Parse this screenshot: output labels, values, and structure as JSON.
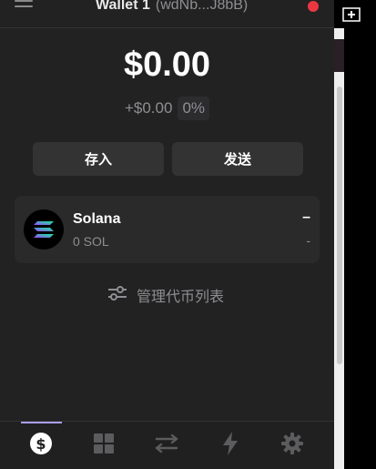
{
  "header": {
    "wallet_name": "Wallet 1",
    "wallet_address": "(wdNb...J8bB)",
    "status_color": "#eb3742"
  },
  "balance": {
    "total": "$0.00",
    "change_value": "+$0.00",
    "change_percent": "0%"
  },
  "actions": {
    "deposit_label": "存入",
    "send_label": "发送"
  },
  "tokens": [
    {
      "name": "Solana",
      "amount": "0 SOL",
      "value": "–",
      "change": "-",
      "icon": "solana-logo"
    }
  ],
  "manage": {
    "label": "管理代币列表",
    "icon": "sliders-icon"
  },
  "tabbar": {
    "tabs": [
      {
        "name": "tab-wallet",
        "icon": "dollar-icon",
        "active": true
      },
      {
        "name": "tab-collectibles",
        "icon": "grid-icon",
        "active": false
      },
      {
        "name": "tab-swap",
        "icon": "swap-icon",
        "active": false
      },
      {
        "name": "tab-activity",
        "icon": "lightning-icon",
        "active": false
      },
      {
        "name": "tab-settings",
        "icon": "gear-icon",
        "active": false
      }
    ],
    "accent_color": "#ab9ff2"
  }
}
